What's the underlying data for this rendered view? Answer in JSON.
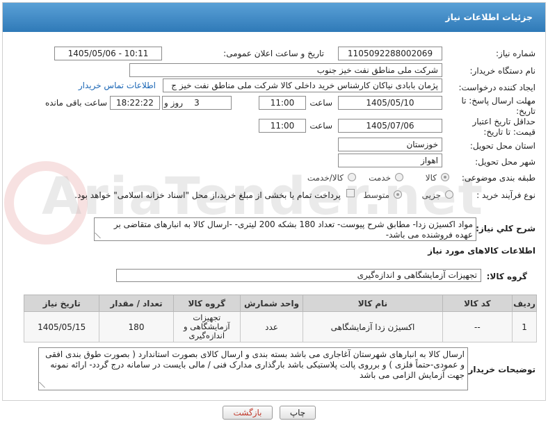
{
  "title": "جزئیات اطلاعات نیاز",
  "fields": {
    "need_number_label": "شماره نیاز:",
    "need_number": "1105092288002069",
    "announce_label": "تاریخ و ساعت اعلان عمومی:",
    "announce_value": "1405/05/06 - 10:11",
    "buyer_label": "نام دستگاه خریدار:",
    "buyer_value": "شرکت ملی مناطق نفت خیز جنوب",
    "creator_label": "ایجاد کننده درخواست:",
    "creator_value": "پژمان  بابادی نیاکان  کارشناس خرید داخلی کالا  شرکت ملی مناطق نفت خیز ج",
    "contact_link": "اطلاعات تماس خریدار",
    "deadline_label": "مهلت ارسال پاسخ: تا تاریخ:",
    "deadline_date": "1405/05/10",
    "time_label": "ساعت",
    "deadline_time": "11:00",
    "days_value": "3",
    "days_label": "روز و",
    "remaining_time": "18:22:22",
    "remaining_label": "ساعت باقی مانده",
    "validity_label": "حداقل تاریخ اعتبار قیمت: تا تاریخ:",
    "validity_date": "1405/07/06",
    "validity_time": "11:00",
    "province_label": "استان محل تحویل:",
    "province_value": "خوزستان",
    "city_label": "شهر محل تحویل:",
    "city_value": "اهواز",
    "category_label": "طبقه بندی موضوعی:",
    "category_options": [
      "کالا",
      "خدمت",
      "کالا/خدمت"
    ],
    "process_label": "نوع فرآیند خرید :",
    "process_options": [
      "جزیی",
      "متوسط"
    ],
    "payment_note": "پرداخت تمام یا بخشی از مبلغ خرید،از محل \"اسناد خزانه اسلامی\" خواهد بود."
  },
  "summary_label": "شرح کلي نياز:",
  "summary_text": "مواد اکسیژن زدا- مطابق شرح پیوست- تعداد 180 بشکه 200 لیتری- -ارسال کالا به انبارهای متقاضی بر عهده فروشنده می باشد-",
  "goods_info_title": "اطلاعات کالاهای مورد نیاز",
  "goods_group_label": "گروه کالا:",
  "goods_group_value": "تجهیزات آزمایشگاهی و اندازه‌گیری",
  "table": {
    "headers": [
      "ردیف",
      "کد کالا",
      "نام کالا",
      "واحد شمارش",
      "گروه کالا",
      "تعداد / مقدار",
      "تاریخ نیاز"
    ],
    "rows": [
      [
        "1",
        "--",
        "اکسیژن زدا آزمایشگاهی",
        "عدد",
        "تجهیزات آزمایشگاهی و اندازه‌گیری",
        "180",
        "1405/05/15"
      ]
    ]
  },
  "notes_label": "توضیحات خریدار:",
  "notes_text": "ارسال کالا به انبارهای  شهرستان آغاجاری می باشد بسته بندی و ارسال کالای بصورت استاندارد ( بصورت طوق بندی افقی و عمودی-حتماً فلزی ) و برروی پالت پلاستیکی  باشد بارگذاری مدارک فنی / مالی بایست  در سامانه درج گردد- ارائه نمونه جهت آزمایش الزامی می باشد",
  "buttons": {
    "print": "چاپ",
    "back": "بازگشت"
  },
  "watermark": "AriaTender.net"
}
